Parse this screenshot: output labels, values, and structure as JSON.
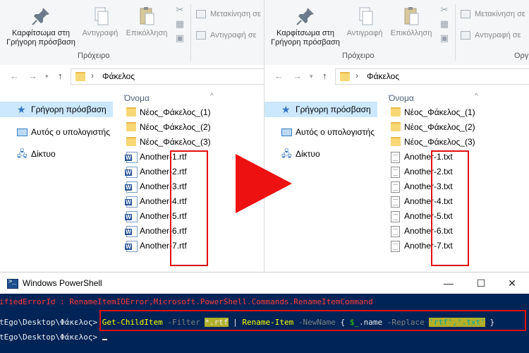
{
  "ribbon": {
    "pin_label": "Καρφίτσωμα στη Γρήγορη πρόσβαση",
    "copy_label": "Αντιγραφή",
    "paste_label": "Επικόλληση",
    "move_to_label": "Μετακίνηση σε",
    "copy_to_label": "Αντιγραφή σε",
    "group_clipboard": "Πρόχειρο",
    "group_organize": "Οργ"
  },
  "address": {
    "folder": "Φάκελος",
    "separator": "›"
  },
  "nav": {
    "quick_access": "Γρήγορη πρόσβαση",
    "this_pc": "Αυτός ο υπολογιστής",
    "network": "Δίκτυο"
  },
  "files_header": "Όνομα",
  "folders": [
    "Νέος_Φάκελος_(1)",
    "Νέος_Φάκελος_(2)",
    "Νέος_Φάκελος_(3)"
  ],
  "files_before": [
    "Another-1.rtf",
    "Another-2.rtf",
    "Another-3.rtf",
    "Another-4.rtf",
    "Another-5.rtf",
    "Another-6.rtf",
    "Another-7.rtf"
  ],
  "files_after": [
    "Another-1.txt",
    "Another-2.txt",
    "Another-3.txt",
    "Another-4.txt",
    "Another-5.txt",
    "Another-6.txt",
    "Another-7.txt"
  ],
  "powershell": {
    "title": "Windows PowerShell",
    "error_line": "ifiedErrorId : RenameItemIOError,Microsoft.PowerShell.Commands.RenameItemCommand",
    "prompt": "tEgo\\Desktop\\Φάκελος>",
    "cmd_gci": "Get-ChildItem",
    "param_filter": "-Filter",
    "filter_value": "*.rtf",
    "pipe": "|",
    "cmd_rename": "Rename-Item",
    "param_newname": "-NewName",
    "brace_open": "{",
    "var": "$_",
    "member": ".name",
    "param_replace": "-Replace",
    "replace_values": "'rtf','.txt'",
    "brace_close": "}",
    "prompt2": "tEgo\\Desktop\\Φάκελος>"
  },
  "colors": {
    "highlight_red": "#e01010",
    "selection": "#cce8ff",
    "console_bg": "#012456"
  }
}
